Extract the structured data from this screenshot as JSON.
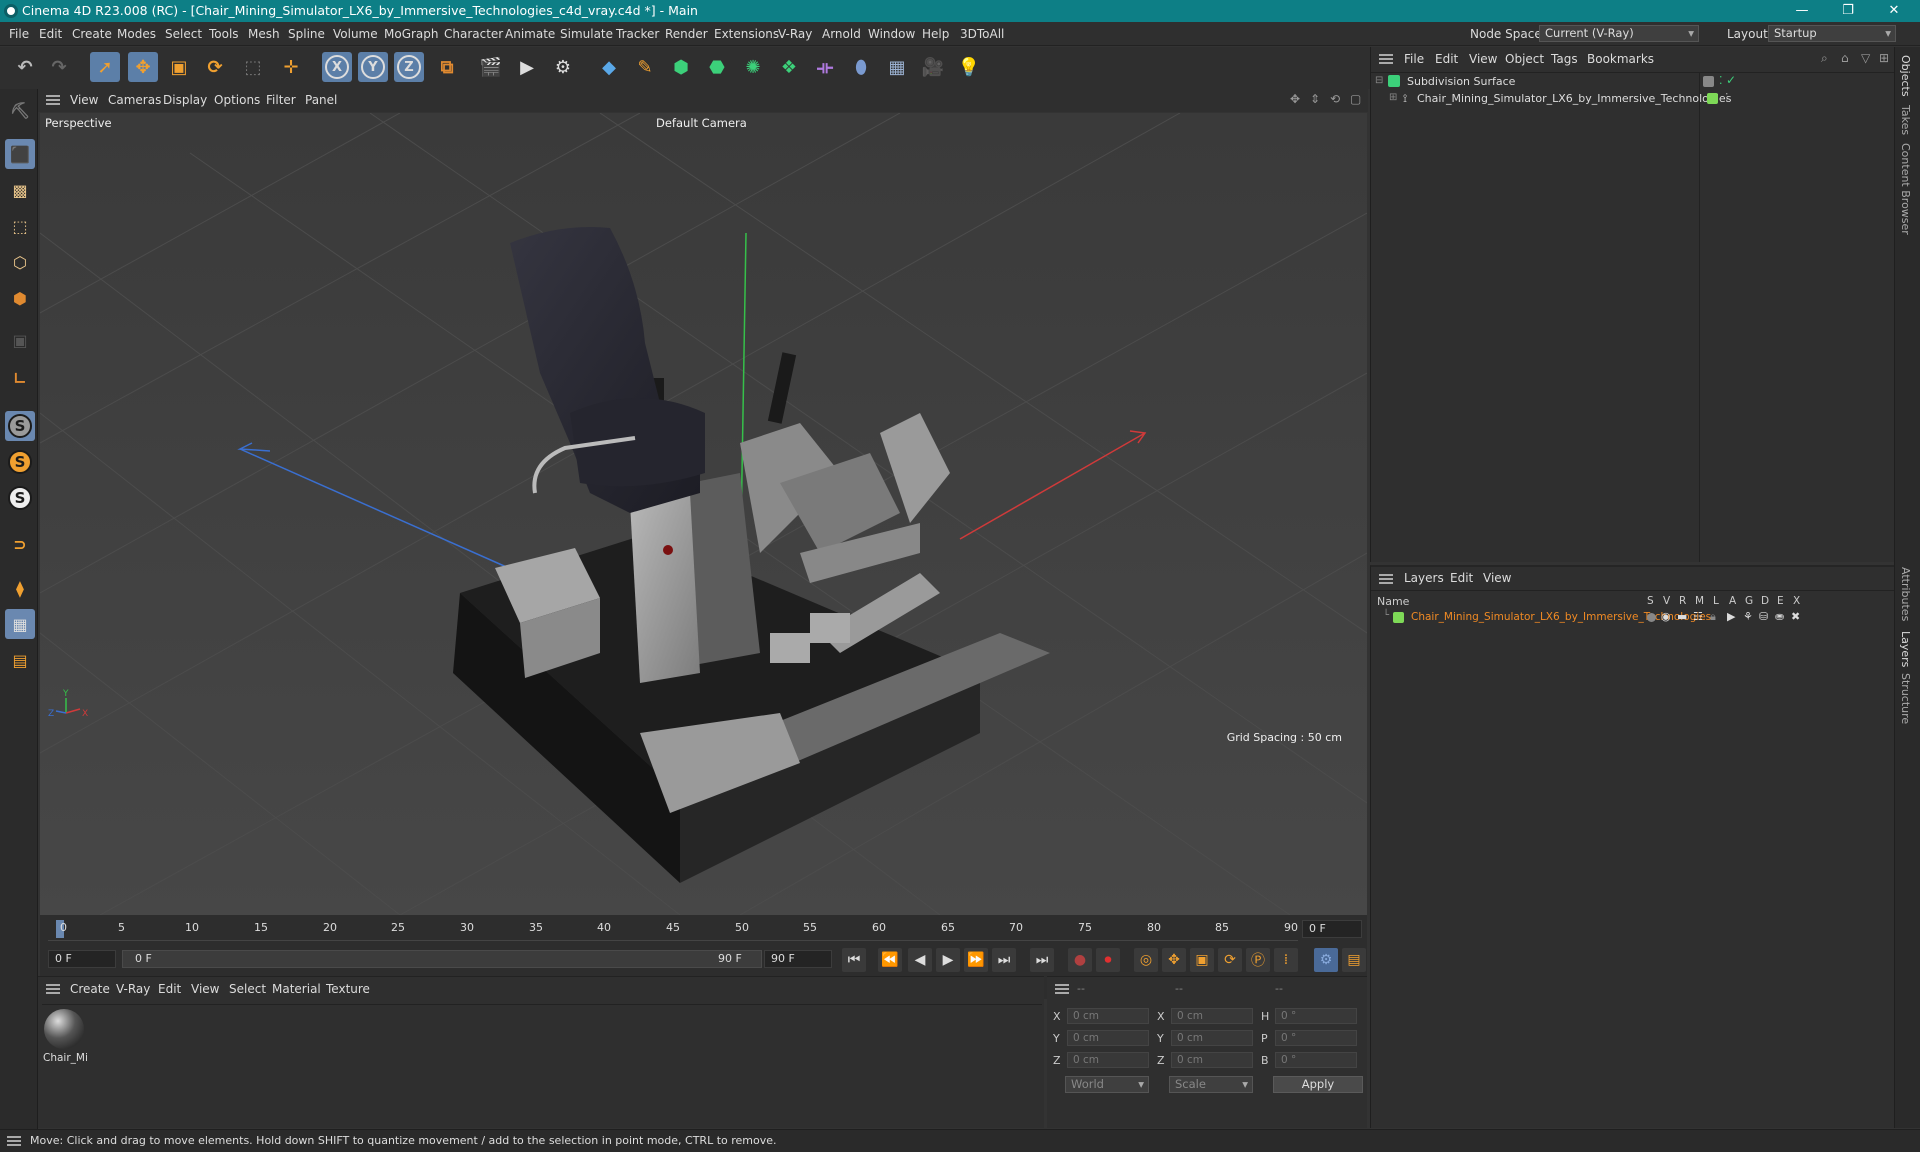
{
  "window": {
    "title": "Cinema 4D R23.008 (RC) - [Chair_Mining_Simulator_LX6_by_Immersive_Technologies_c4d_vray.c4d *] - Main",
    "controls": [
      "—",
      "❐",
      "✕"
    ]
  },
  "menubar": {
    "items": [
      "File",
      "Edit",
      "Create",
      "Modes",
      "Select",
      "Tools",
      "Mesh",
      "Spline",
      "Volume",
      "MoGraph",
      "Character",
      "Animate",
      "Simulate",
      "Tracker",
      "Render",
      "Extensions",
      "V-Ray",
      "Arnold",
      "Window",
      "Help",
      "3DToAll"
    ],
    "node_space_label": "Node Space:",
    "node_space_value": "Current (V-Ray)",
    "layout_label": "Layout:",
    "layout_value": "Startup"
  },
  "toolbar": {
    "axis_x": "X",
    "axis_y": "Y",
    "axis_z": "Z"
  },
  "viewport": {
    "menu": [
      "View",
      "Cameras",
      "Display",
      "Options",
      "Filter",
      "Panel"
    ],
    "label": "Perspective",
    "camera": "Default Camera",
    "grid_spacing": "Grid Spacing : 50 cm",
    "gizmo_y": "Y",
    "gizmo_x": "X",
    "gizmo_z": "Z"
  },
  "timeline": {
    "ticks": [
      "0",
      "5",
      "10",
      "15",
      "20",
      "25",
      "30",
      "35",
      "40",
      "45",
      "50",
      "55",
      "60",
      "65",
      "70",
      "75",
      "80",
      "85",
      "90"
    ],
    "current_frame": "0 F",
    "start_frame": "0 F",
    "range_start": "0 F",
    "range_end": "90 F",
    "end_frame": "90 F"
  },
  "materials": {
    "menu": [
      "Create",
      "V-Ray",
      "Edit",
      "View",
      "Select",
      "Material",
      "Texture"
    ],
    "items": [
      {
        "name": "Chair_Mi"
      }
    ]
  },
  "coords": {
    "headers": [
      "--",
      "--",
      "--"
    ],
    "rows": [
      {
        "a": "X",
        "av": "0 cm",
        "b": "X",
        "bv": "0 cm",
        "c": "H",
        "cv": "0 °"
      },
      {
        "a": "Y",
        "av": "0 cm",
        "b": "Y",
        "bv": "0 cm",
        "c": "P",
        "cv": "0 °"
      },
      {
        "a": "Z",
        "av": "0 cm",
        "b": "Z",
        "bv": "0 cm",
        "c": "B",
        "cv": "0 °"
      }
    ],
    "space": "World",
    "mode": "Scale",
    "apply": "Apply"
  },
  "object_manager": {
    "menu": [
      "File",
      "Edit",
      "View",
      "Object",
      "Tags",
      "Bookmarks"
    ],
    "objects": [
      {
        "name": "Subdivision Surface"
      },
      {
        "name": "Chair_Mining_Simulator_LX6_by_Immersive_Technologies"
      }
    ]
  },
  "layer_manager": {
    "menu": [
      "Layers",
      "Edit",
      "View"
    ],
    "col_name": "Name",
    "col_flags": [
      "S",
      "V",
      "R",
      "M",
      "L",
      "A",
      "G",
      "D",
      "E",
      "X"
    ],
    "layers": [
      {
        "name": "Chair_Mining_Simulator_LX6_by_Immersive_Technologies",
        "color": "#f08a24"
      }
    ]
  },
  "right_tabs": [
    "Objects",
    "Takes",
    "Content Browser",
    "Attributes",
    "Layers",
    "Structure"
  ],
  "status": "Move: Click and drag to move elements. Hold down SHIFT to quantize movement / add to the selection in point mode, CTRL to remove.",
  "colors": {
    "titlebar": "#0d7f86",
    "selection": "#5c7fa8",
    "accent": "#f08a24",
    "layer_green": "#7ed957"
  }
}
